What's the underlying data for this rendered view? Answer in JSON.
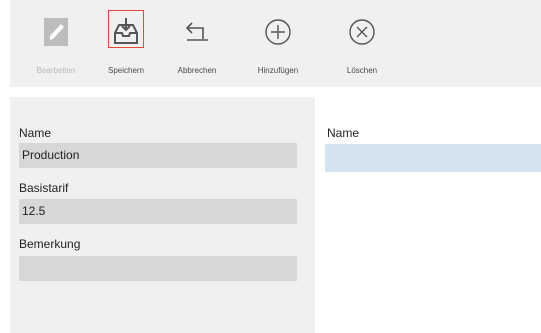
{
  "toolbar": {
    "buttons": [
      {
        "id": "edit",
        "label": "Bearbeiten",
        "icon": "pencil-icon",
        "enabled": false
      },
      {
        "id": "save",
        "label": "Speichern",
        "icon": "inbox-save-icon",
        "enabled": true
      },
      {
        "id": "cancel",
        "label": "Abbrechen",
        "icon": "undo-arrow-icon",
        "enabled": true
      },
      {
        "id": "add",
        "label": "Hinzufügen",
        "icon": "plus-circle-icon",
        "enabled": true
      },
      {
        "id": "delete",
        "label": "Löschen",
        "icon": "x-circle-icon",
        "enabled": true
      }
    ],
    "highlight_color": "#e44a3a"
  },
  "form": {
    "name_label": "Name",
    "name_value": "Production",
    "basistarif_label": "Basistarif",
    "basistarif_value": "12.5",
    "bemerkung_label": "Bemerkung",
    "bemerkung_value": ""
  },
  "list": {
    "column_header": "Name",
    "rows": [
      ""
    ],
    "selected_row_color": "#d3e3ef"
  }
}
